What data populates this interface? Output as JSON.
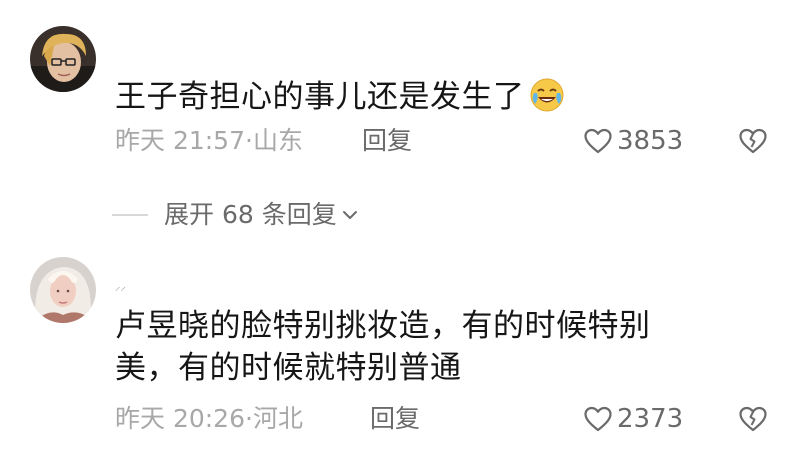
{
  "comments": [
    {
      "username": "",
      "text": "王子奇担心的事儿还是发生了",
      "emoji": "crying-laughing-emoji",
      "time": "昨天 21:57·山东",
      "reply_label": "回复",
      "likes": "3853"
    },
    {
      "username": "⸝⸝",
      "text_line1": "卢昱晓的脸特别挑妆造，有的时候特别",
      "text_line2": "美，有的时候就特别普通",
      "time": "昨天 20:26·河北",
      "reply_label": "回复",
      "likes": "2373"
    }
  ],
  "expand_replies": {
    "label": "展开 68 条回复"
  },
  "icons": {
    "like": "heart-icon",
    "dislike": "broken-heart-icon",
    "expand": "chevron-down-icon"
  },
  "colors": {
    "text": "#161616",
    "meta": "#a8a8a8",
    "action": "#6a6a6a"
  }
}
